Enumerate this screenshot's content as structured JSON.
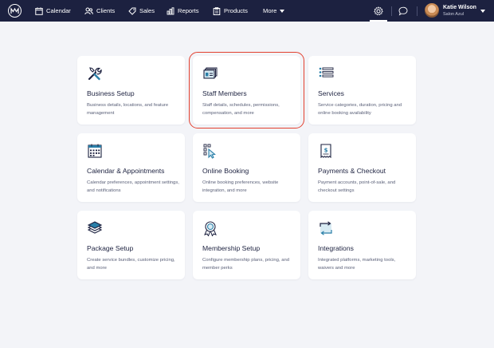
{
  "nav": {
    "items": [
      {
        "label": "Calendar",
        "icon": "calendar-icon"
      },
      {
        "label": "Clients",
        "icon": "clients-icon"
      },
      {
        "label": "Sales",
        "icon": "tag-icon"
      },
      {
        "label": "Reports",
        "icon": "bar-chart-icon"
      },
      {
        "label": "Products",
        "icon": "clipboard-icon"
      },
      {
        "label": "More",
        "icon": "chevron-down-icon"
      }
    ]
  },
  "user": {
    "name": "Katie Wilson",
    "subtitle": "Salon Azul"
  },
  "colors": {
    "nav_bg": "#1c2140",
    "accent": "#2a7fa8",
    "highlight": "#e2402f"
  },
  "cards": [
    {
      "title": "Business Setup",
      "desc": "Business details, locations, and feature management",
      "icon": "tools-icon"
    },
    {
      "title": "Staff Members",
      "desc": "Staff details, schedules, permissions, compensation, and more",
      "icon": "staff-cards-icon",
      "selected": true
    },
    {
      "title": "Services",
      "desc": "Service categories, duration, pricing and online booking availability",
      "icon": "list-icon"
    },
    {
      "title": "Calendar & Appointments",
      "desc": "Calendar preferences, appointment settings, and notifications",
      "icon": "calendar-grid-icon"
    },
    {
      "title": "Online Booking",
      "desc": "Online booking preferences, website integration, and more",
      "icon": "pointer-icon"
    },
    {
      "title": "Payments & Checkout",
      "desc": "Payment accounts, point-of-sale, and checkout settings",
      "icon": "receipt-icon"
    },
    {
      "title": "Package Setup",
      "desc": "Create service bundles, customize pricing, and more",
      "icon": "layers-icon"
    },
    {
      "title": "Membership Setup",
      "desc": "Configure membership plans, pricing, and member perks",
      "icon": "badge-icon"
    },
    {
      "title": "Integrations",
      "desc": "Integrated platforms, marketing tools, waivers and more",
      "icon": "sync-icon"
    }
  ]
}
